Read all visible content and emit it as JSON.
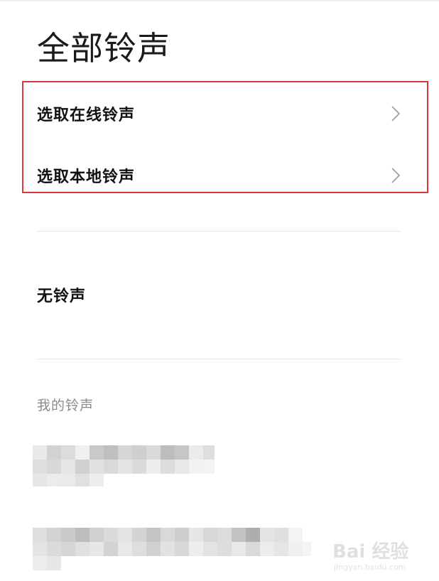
{
  "page": {
    "title": "全部铃声"
  },
  "options": [
    {
      "label": "选取在线铃声",
      "icon": "chevron-right-icon"
    },
    {
      "label": "选取本地铃声",
      "icon": "chevron-right-icon"
    }
  ],
  "none_option": {
    "label": "无铃声"
  },
  "my_ringtones": {
    "section_label": "我的铃声",
    "items": [
      "",
      ""
    ]
  },
  "watermark": {
    "logo": "Bai 经验",
    "url": "jingyan.baidu.com"
  },
  "colors": {
    "highlight": "#d8373a",
    "text": "#111111",
    "muted": "#8a8a8a",
    "divider": "#e8e8e8"
  }
}
